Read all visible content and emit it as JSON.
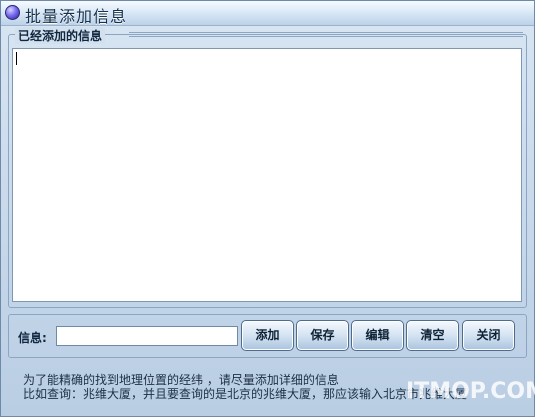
{
  "window": {
    "title": "批量添加信息"
  },
  "group": {
    "legend": "已经添加的信息",
    "textarea_value": ""
  },
  "toolbar": {
    "info_label": "信息:",
    "info_value": "",
    "buttons": {
      "add": "添加",
      "save": "保存",
      "edit": "编辑",
      "clear": "清空",
      "close": "关闭"
    }
  },
  "hint": {
    "line1": "为了能精确的找到地理位置的经纬 ，请尽量添加详细的信息",
    "line2": "比如查询：兆维大厦，并且要查询的是北京的兆维大厦，那应该输入北京市兆维大厦"
  },
  "watermark": "ITMOP.COM",
  "colors": {
    "window_bg": "#c7d8ea",
    "border": "#8ba6c3",
    "text": "#10273f"
  }
}
